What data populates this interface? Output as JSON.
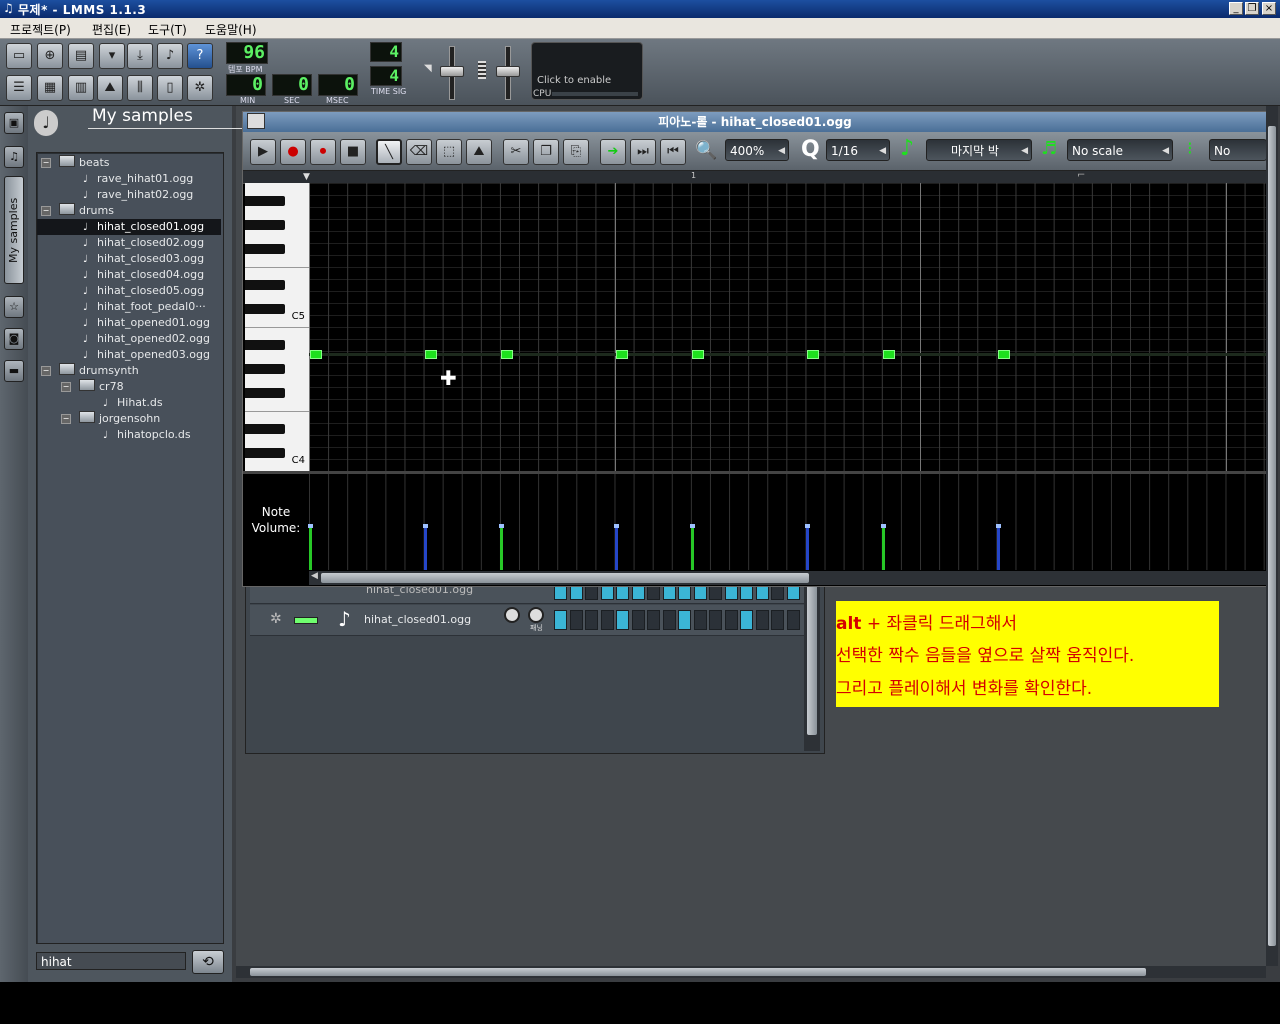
{
  "window": {
    "title": "무제* - LMMS 1.1.3"
  },
  "menu": [
    "프로젝트(P)",
    "편집(E)",
    "도구(T)",
    "도움말(H)"
  ],
  "toolbar": {
    "tempo": "96",
    "tempo_label": "템포 BPM",
    "time": {
      "min": "0",
      "sec": "0",
      "msec": "0"
    },
    "time_labels": {
      "min": "MIN",
      "sec": "SEC",
      "msec": "MSEC"
    },
    "timesig": {
      "num": "4",
      "den": "4",
      "label": "TIME SIG"
    },
    "cpu": {
      "hint": "Click to enable",
      "label": "CPU"
    }
  },
  "browser": {
    "title": "My samples",
    "tab_label": "My samples",
    "filter": "hihat",
    "tree": [
      {
        "label": "beats",
        "type": "folder",
        "level": 0
      },
      {
        "label": "rave_hihat01.ogg",
        "type": "file",
        "level": 1
      },
      {
        "label": "rave_hihat02.ogg",
        "type": "file",
        "level": 1
      },
      {
        "label": "drums",
        "type": "folder",
        "level": 0
      },
      {
        "label": "hihat_closed01.ogg",
        "type": "file",
        "level": 1,
        "selected": true
      },
      {
        "label": "hihat_closed02.ogg",
        "type": "file",
        "level": 1
      },
      {
        "label": "hihat_closed03.ogg",
        "type": "file",
        "level": 1
      },
      {
        "label": "hihat_closed04.ogg",
        "type": "file",
        "level": 1
      },
      {
        "label": "hihat_closed05.ogg",
        "type": "file",
        "level": 1
      },
      {
        "label": "hihat_foot_pedal0···",
        "type": "file",
        "level": 1
      },
      {
        "label": "hihat_opened01.ogg",
        "type": "file",
        "level": 1
      },
      {
        "label": "hihat_opened02.ogg",
        "type": "file",
        "level": 1
      },
      {
        "label": "hihat_opened03.ogg",
        "type": "file",
        "level": 1
      },
      {
        "label": "drumsynth",
        "type": "folder",
        "level": 0
      },
      {
        "label": "cr78",
        "type": "folder",
        "level": 1
      },
      {
        "label": "Hihat.ds",
        "type": "file",
        "level": 2
      },
      {
        "label": "jorgensohn",
        "type": "folder",
        "level": 1
      },
      {
        "label": "hihatopclo.ds",
        "type": "file",
        "level": 2
      }
    ]
  },
  "piano_roll": {
    "title": "피아노-롤 - hihat_closed01.ogg",
    "zoom": "400%",
    "quantize": "1/16",
    "note_length": "마지막 박",
    "scale": "No scale",
    "chord": "No chord",
    "key_labels": {
      "c5": "C5",
      "c4": "C4"
    },
    "bar_marker": "1",
    "volume_label": "Note Volume:",
    "note_step_positions": [
      0,
      6,
      10,
      16,
      20,
      26,
      30,
      36
    ],
    "note_volume_colors": [
      "green",
      "blue",
      "green",
      "blue",
      "green",
      "blue",
      "green",
      "blue"
    ]
  },
  "bb_editor": {
    "tracks": [
      {
        "name": "hihat_closed01.ogg",
        "steps": [
          1,
          1,
          0,
          1,
          1,
          1,
          0,
          1,
          1,
          1,
          0,
          1,
          1,
          1,
          0,
          1
        ]
      },
      {
        "name": "hihat_closed01.ogg",
        "steps": [
          1,
          0,
          0,
          0,
          1,
          0,
          0,
          0,
          1,
          0,
          0,
          0,
          1,
          0,
          0,
          0
        ]
      }
    ],
    "panning_label": "패닝"
  },
  "annotation": {
    "lines": [
      "alt + 좌클릭 드래그해서",
      "선택한 짝수 음들을 옆으로 살짝 움직인다.",
      "그리고 플레이해서 변화를 확인한다."
    ],
    "bold_word": "alt"
  },
  "colors": {
    "note_green": "#1ee01e",
    "step_on": "#3bb5d6",
    "annotation_bg": "#ffff00",
    "annotation_text": "#d40000"
  }
}
